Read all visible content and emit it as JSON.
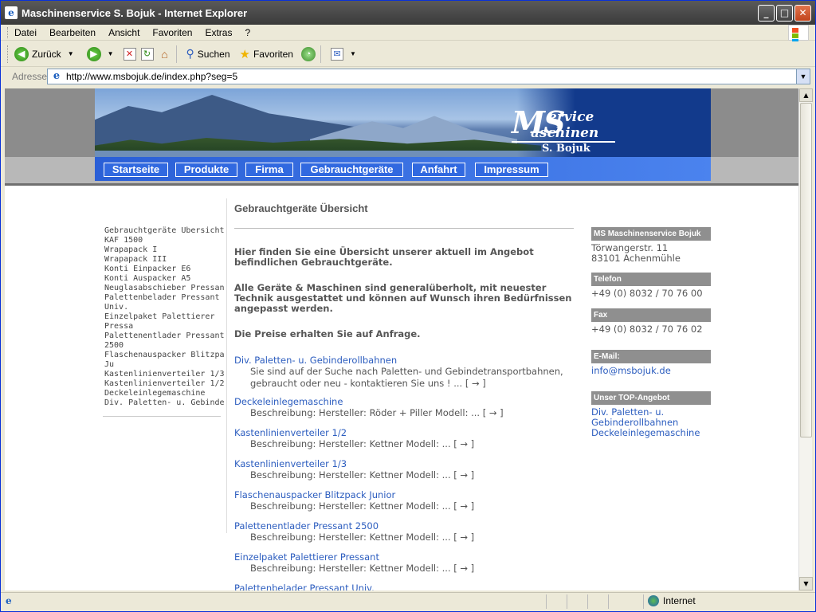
{
  "window": {
    "title": "Maschinenservice S. Bojuk - Internet Explorer",
    "icon": "ie-icon",
    "controls": [
      "_",
      "□",
      "✕"
    ]
  },
  "menu": [
    "Datei",
    "Bearbeiten",
    "Ansicht",
    "Favoriten",
    "Extras",
    "?"
  ],
  "toolbar": {
    "back": "Zurück",
    "search": "Suchen",
    "favorites": "Favoriten"
  },
  "address": {
    "label": "Adresse",
    "url": "http://www.msbojuk.de/index.php?seg=5"
  },
  "status": {
    "zone": "Internet"
  },
  "site": {
    "logo": {
      "big": "MS",
      "service": "ervice",
      "maschinen": "aschinen",
      "name": "S. Bojuk"
    },
    "nav": [
      "Startseite",
      "Produkte",
      "Firma",
      "Gebrauchtgeräte",
      "Anfahrt",
      "Impressum"
    ],
    "left_nav": [
      "Gebrauchtgeräte Übersicht",
      "KAF 1500",
      "Wrapapack I",
      "Wrapapack III",
      "Konti Einpacker E6",
      "Konti Auspacker A5",
      "Neuglasabschieber Pressant",
      "Palettenbelader Pressant",
      "Univ.",
      "Einzelpaket Palettierer",
      "Pressa",
      "Palettenentlader Pressant",
      "2500",
      "Flaschenauspacker Blitzpack",
      "Ju",
      "Kastenlinienverteiler 1/3",
      "Kastenlinienverteiler 1/2",
      "Deckeleinlegemaschine",
      "Div. Paletten- u. Gebinderollb"
    ],
    "main": {
      "title": "Gebrauchtgeräte Übersicht",
      "intro1": "Hier finden Sie eine Übersicht unserer aktuell im Angebot befindlichen Gebrauchtgeräte.",
      "intro2": "Alle Geräte & Maschinen sind generalüberholt, mit neuester Technik ausgestattet und können auf Wunsch ihren Bedürfnissen angepasst werden.",
      "intro3": "Die Preise erhalten Sie auf Anfrage.",
      "items": [
        {
          "title": "Div. Paletten- u. Gebinderollbahnen",
          "desc": "Sie sind auf der Suche nach Paletten- und Gebindetransportbahnen, gebraucht oder neu - kontaktieren Sie uns ! ... [ → ]"
        },
        {
          "title": "Deckeleinlegemaschine",
          "desc": "Beschreibung:   Hersteller:   Röder + Piller Modell:   ... [ → ]"
        },
        {
          "title": "Kastenlinienverteiler 1/2",
          "desc": "Beschreibung:   Hersteller:   Kettner Modell:   ... [ → ]"
        },
        {
          "title": "Kastenlinienverteiler 1/3",
          "desc": "Beschreibung:   Hersteller:   Kettner Modell:   ... [ → ]"
        },
        {
          "title": "Flaschenauspacker Blitzpack Junior",
          "desc": "Beschreibung:   Hersteller:   Kettner Modell:   ... [ → ]"
        },
        {
          "title": "Palettenentlader Pressant 2500",
          "desc": "Beschreibung:   Hersteller:   Kettner Modell:   ... [ → ]"
        },
        {
          "title": "Einzelpaket Palettierer Pressant",
          "desc": "Beschreibung:   Hersteller:   Kettner Modell:   ... [ → ]"
        },
        {
          "title": "Palettenbelader Pressant Univ.",
          "desc": ""
        }
      ]
    },
    "right": {
      "company_head": "MS Maschinenservice Bojuk",
      "street": "Törwangerstr. 11",
      "city": "83101 Achenmühle",
      "phone_head": "Telefon",
      "phone": "+49 (0) 8032 / 70 76 00",
      "fax_head": "Fax",
      "fax": "+49 (0) 8032 / 70 76 02",
      "email_head": "E-Mail:",
      "email": "info@msbojuk.de",
      "top_head": "Unser TOP-Angebot",
      "top_items": [
        "Div. Paletten- u. Gebinderollbahnen",
        "Deckeleinlegemaschine"
      ]
    }
  }
}
